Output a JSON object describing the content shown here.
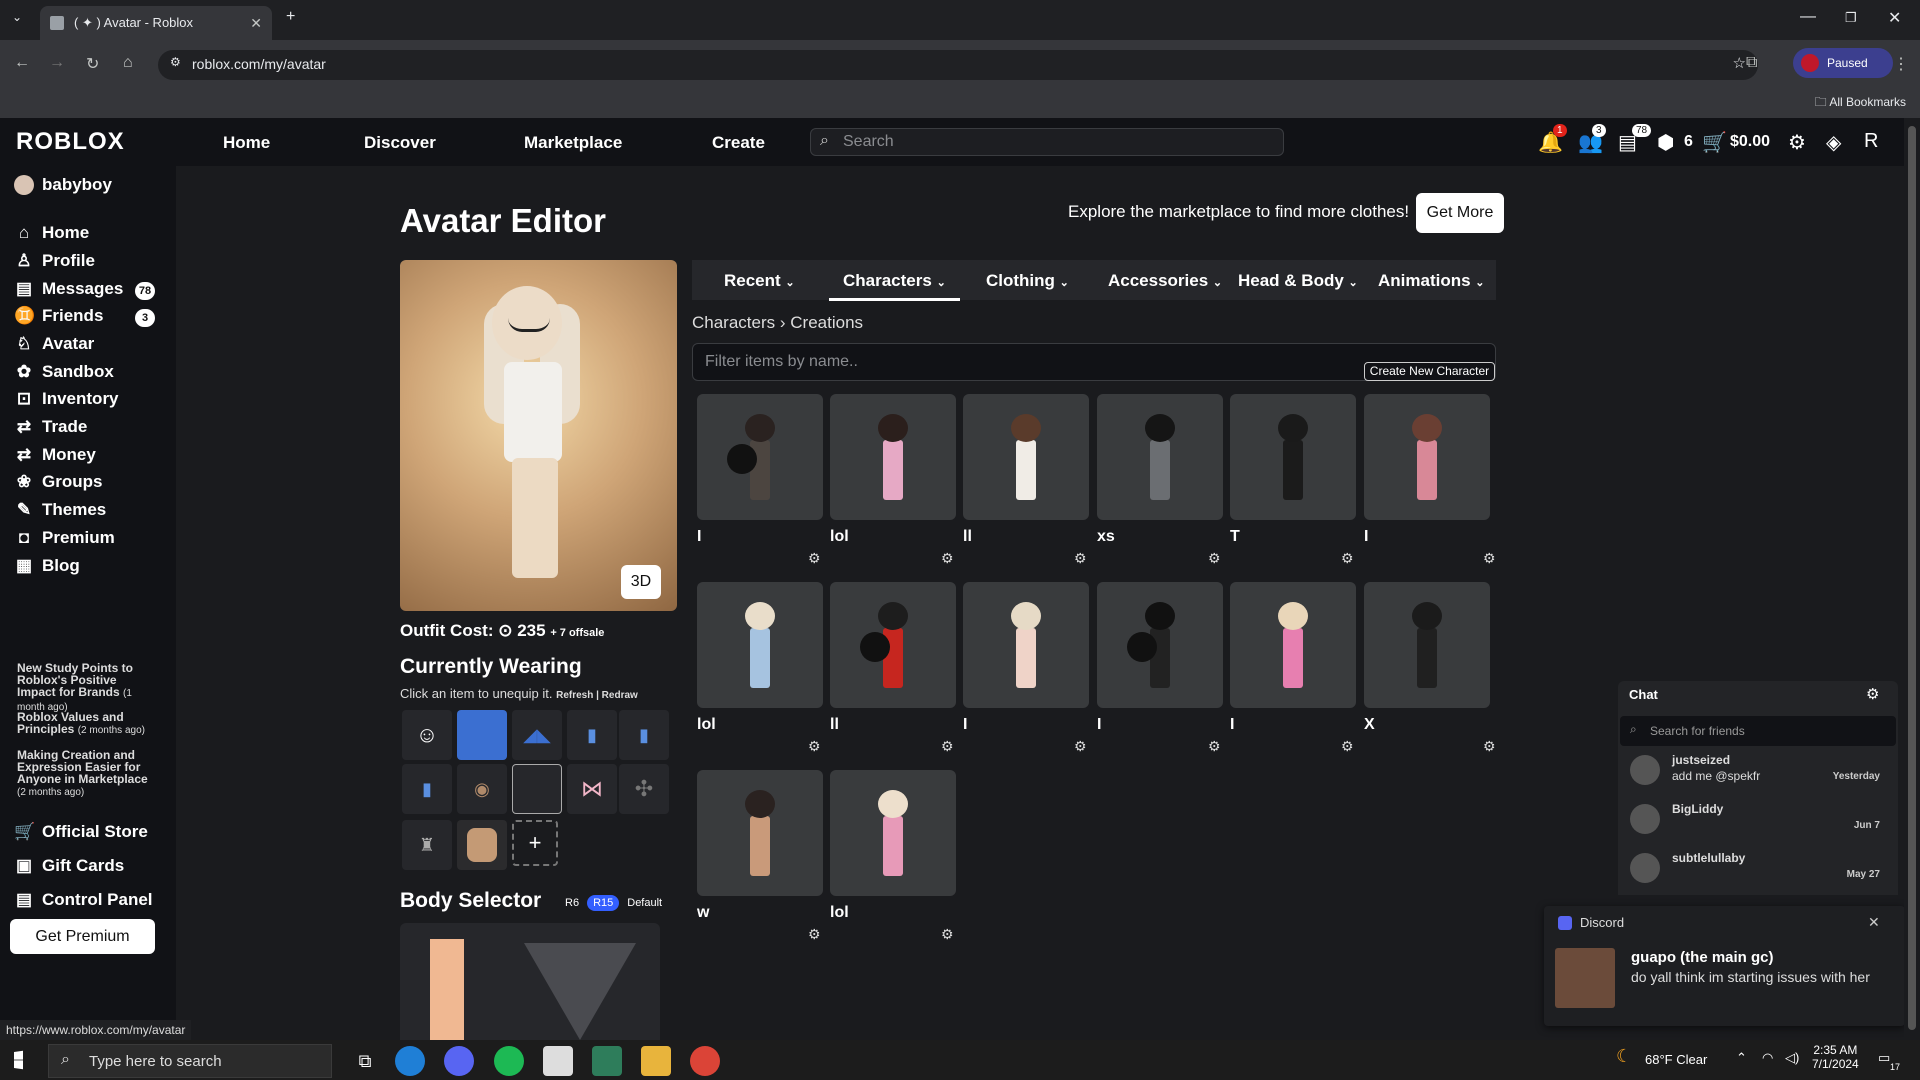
{
  "browser": {
    "tab_title": "( ✦ ) Avatar - Roblox",
    "url": "roblox.com/my/avatar",
    "profile_label": "Paused",
    "bookmarks_label": "All Bookmarks",
    "status_url": "https://www.roblox.com/my/avatar"
  },
  "header": {
    "logo": "ROBLOX",
    "nav": [
      "Home",
      "Discover",
      "Marketplace",
      "Create"
    ],
    "search_placeholder": "Search",
    "notifications_badge": "1",
    "friends_badge": "3",
    "messages_badge": "78",
    "robux_count": "6",
    "balance": "$0.00"
  },
  "sidebar": {
    "username": "babyboy",
    "items": [
      {
        "label": "Home",
        "icon": "house-icon"
      },
      {
        "label": "Profile",
        "icon": "person-icon"
      },
      {
        "label": "Messages",
        "icon": "messages-icon",
        "badge": "78"
      },
      {
        "label": "Friends",
        "icon": "friends-icon",
        "badge": "3"
      },
      {
        "label": "Avatar",
        "icon": "avatar-icon"
      },
      {
        "label": "Sandbox",
        "icon": "sandbox-icon"
      },
      {
        "label": "Inventory",
        "icon": "inventory-icon"
      },
      {
        "label": "Trade",
        "icon": "trade-icon"
      },
      {
        "label": "Money",
        "icon": "money-icon"
      },
      {
        "label": "Groups",
        "icon": "groups-icon"
      },
      {
        "label": "Themes",
        "icon": "themes-icon"
      },
      {
        "label": "Premium",
        "icon": "premium-icon"
      },
      {
        "label": "Blog",
        "icon": "blog-icon"
      }
    ],
    "blog_posts": [
      {
        "title": "New Study Points to Roblox's Positive Impact for Brands",
        "time": "(1 month ago)"
      },
      {
        "title": "Roblox Values and Principles",
        "time": "(2 months ago)"
      },
      {
        "title": "Making Creation and Expression Easier for Anyone in Marketplace",
        "time": "(2 months ago)"
      }
    ],
    "bottom_items": [
      {
        "label": "Official Store",
        "icon": "store-icon"
      },
      {
        "label": "Gift Cards",
        "icon": "gift-card-icon"
      },
      {
        "label": "Control Panel",
        "icon": "control-panel-icon"
      }
    ],
    "premium_button": "Get Premium"
  },
  "editor": {
    "title": "Avatar Editor",
    "explore_text": "Explore the marketplace to find more clothes!",
    "get_more": "Get More",
    "btn_3d": "3D",
    "outfit_cost_label": "Outfit Cost:",
    "outfit_cost_value": "235",
    "outfit_cost_extra": "+ 7 offsale",
    "currently_wearing": "Currently Wearing",
    "wearing_hint": "Click an item to unequip it.",
    "refresh_redraw": "Refresh | Redraw",
    "body_selector": "Body Selector",
    "body_options": [
      "R6",
      "R15",
      "Default"
    ]
  },
  "tabs": [
    "Recent",
    "Characters",
    "Clothing",
    "Accessories",
    "Head & Body",
    "Animations"
  ],
  "active_tab": "Characters",
  "breadcrumb": {
    "root": "Characters",
    "sep": "›",
    "leaf": "Creations"
  },
  "filter_placeholder": "Filter items by name..",
  "create_new_character": "Create New Character",
  "characters": [
    {
      "name": "I",
      "hair": "#2a2220",
      "body": "#4c4540",
      "bomb": true
    },
    {
      "name": "lol",
      "hair": "#2b1f1c",
      "body": "#e6a9c5",
      "bomb": false
    },
    {
      "name": "ll",
      "hair": "#5a3b2b",
      "body": "#f0ece6",
      "bomb": false
    },
    {
      "name": "xs",
      "hair": "#151515",
      "body": "#6b6e72",
      "bomb": false
    },
    {
      "name": "T",
      "hair": "#1a1a1a",
      "body": "#1b1b1b",
      "bomb": false
    },
    {
      "name": "I",
      "hair": "#6a3f33",
      "body": "#d88897",
      "bomb": false
    },
    {
      "name": "lol",
      "hair": "#e9ddca",
      "body": "#a6c3e0",
      "bomb": false
    },
    {
      "name": "ll",
      "hair": "#1d1d1d",
      "body": "#c6261f",
      "bomb": true
    },
    {
      "name": "I",
      "hair": "#e6dac6",
      "body": "#efd3c8",
      "bomb": false
    },
    {
      "name": "I",
      "hair": "#111111",
      "body": "#222222",
      "bomb": true
    },
    {
      "name": "I",
      "hair": "#e9d6b9",
      "body": "#e77fb0",
      "bomb": false
    },
    {
      "name": "X",
      "hair": "#1b1b1b",
      "body": "#202020",
      "bomb": false
    },
    {
      "name": "w",
      "hair": "#2a2220",
      "body": "#c99a7a",
      "bomb": false
    },
    {
      "name": "lol",
      "hair": "#eddfcc",
      "body": "#e79ab8",
      "bomb": false
    }
  ],
  "chat": {
    "title": "Chat",
    "search_placeholder": "Search for friends",
    "conversations": [
      {
        "name": "justseized",
        "message": "add me @spekfr",
        "date": "Yesterday"
      },
      {
        "name": "BigLiddy",
        "message": "",
        "date": "Jun 7"
      },
      {
        "name": "subtlelullaby",
        "message": "",
        "date": "May 27"
      }
    ]
  },
  "discord_toast": {
    "app": "Discord",
    "title": "guapo (the main gc)",
    "message": "do yall think im starting issues with her"
  },
  "taskbar": {
    "search_placeholder": "Type here to search",
    "weather": "68°F  Clear",
    "time": "2:35 AM",
    "date": "7/1/2024",
    "notif_count": "17"
  }
}
